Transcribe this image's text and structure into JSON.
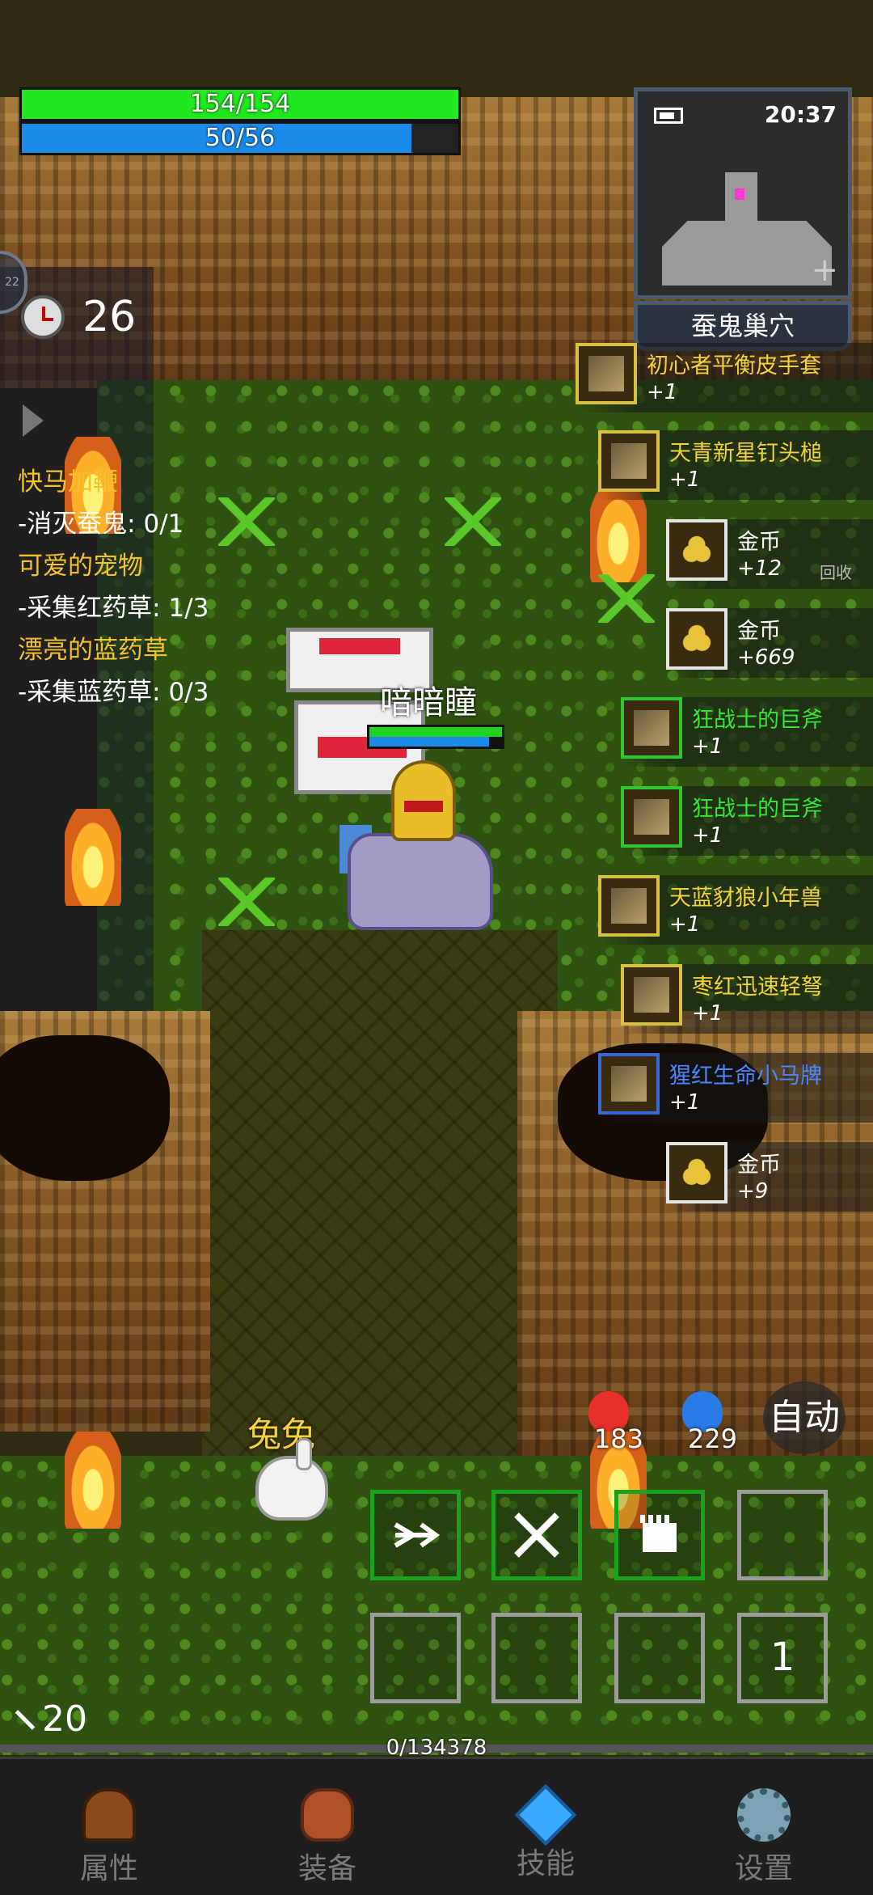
{
  "hud": {
    "hp_text": "154/154",
    "hp_fraction": 1.0,
    "mp_text": "50/56",
    "mp_fraction": 0.893,
    "timer": "26",
    "side_tab": "22"
  },
  "minimap": {
    "clock": "20:37",
    "zone": "蚕鬼巢穴"
  },
  "quests": [
    {
      "title": "快马加鞭",
      "step": "-消灭蚕鬼: 0/1"
    },
    {
      "title": "可爱的宠物",
      "step": "-采集红药草: 1/3"
    },
    {
      "title": "漂亮的蓝药草",
      "step": "-采集蓝药草: 0/3"
    }
  ],
  "loot": [
    {
      "name": "初心者平衡皮手套",
      "count": "+1",
      "color": "#f2d23a",
      "frame": "#d7c043"
    },
    {
      "name": "天青新星钉头槌",
      "count": "+1",
      "color": "#f2d23a",
      "frame": "#d7c043"
    },
    {
      "name": "金币",
      "count": "+12",
      "extra": "回收",
      "color": "#ffffff",
      "frame": "#e5e5e5"
    },
    {
      "name": "金币",
      "count": "+669",
      "color": "#ffffff",
      "frame": "#e5e5e5"
    },
    {
      "name": "狂战士的巨斧",
      "count": "+1",
      "color": "#33e638",
      "frame": "#2ec82e"
    },
    {
      "name": "狂战士的巨斧",
      "count": "+1",
      "color": "#33e638",
      "frame": "#2ec82e"
    },
    {
      "name": "天蓝豺狼小年兽",
      "count": "+1",
      "color": "#f2d23a",
      "frame": "#d7c043"
    },
    {
      "name": "枣红迅速轻弩",
      "count": "+1",
      "color": "#f2d23a",
      "frame": "#d7c043"
    },
    {
      "name": "猩红生命小马牌",
      "count": "+1",
      "color": "#4a86ff",
      "frame": "#3a66d6"
    },
    {
      "name": "金币",
      "count": "+9",
      "color": "#ffffff",
      "frame": "#e5e5e5"
    }
  ],
  "player": {
    "name": "喑暗瞳",
    "hp_fraction": 1.0,
    "mp_fraction": 0.9
  },
  "pet": {
    "name": "兔兔"
  },
  "potions": {
    "red_count": "183",
    "blue_count": "229"
  },
  "auto_label": "自动",
  "skills": {
    "page_number": "1"
  },
  "arrows": "20",
  "xp": {
    "text": "0/134378",
    "fraction": 0.0
  },
  "nav": [
    {
      "label": "属性",
      "icon": "helmet-icon"
    },
    {
      "label": "装备",
      "icon": "bag-icon"
    },
    {
      "label": "技能",
      "icon": "crystal-icon"
    },
    {
      "label": "设置",
      "icon": "gear-icon"
    }
  ]
}
